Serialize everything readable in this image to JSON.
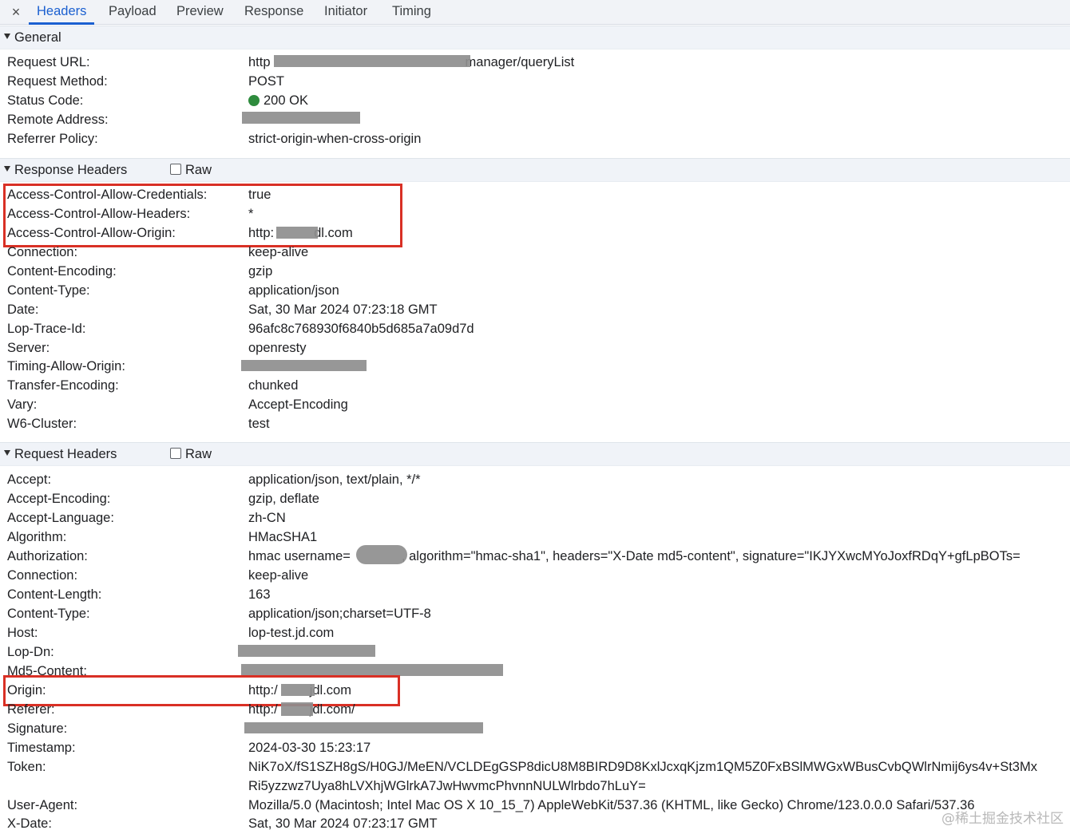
{
  "tabs": {
    "close_icon": "×",
    "items": [
      {
        "label": "Headers",
        "active": true
      },
      {
        "label": "Payload"
      },
      {
        "label": "Preview"
      },
      {
        "label": "Response"
      },
      {
        "label": "Initiator"
      },
      {
        "label": "Timing"
      }
    ]
  },
  "general": {
    "title": "General",
    "rows": [
      {
        "key": "Request URL:",
        "value_prefix": "http",
        "value_suffix": "manager/queryList"
      },
      {
        "key": "Request Method:",
        "value": "POST"
      },
      {
        "key": "Status Code:",
        "value": "200 OK"
      },
      {
        "key": "Remote Address:",
        "value": ""
      },
      {
        "key": "Referrer Policy:",
        "value": "strict-origin-when-cross-origin"
      }
    ]
  },
  "response_headers": {
    "title": "Response Headers",
    "raw_label": "Raw",
    "rows": [
      {
        "key": "Access-Control-Allow-Credentials:",
        "value": "true"
      },
      {
        "key": "Access-Control-Allow-Headers:",
        "value": "*"
      },
      {
        "key": "Access-Control-Allow-Origin:",
        "value_prefix": "http:",
        "value_suffix": "dl.com"
      },
      {
        "key": "Connection:",
        "value": "keep-alive"
      },
      {
        "key": "Content-Encoding:",
        "value": "gzip"
      },
      {
        "key": "Content-Type:",
        "value": "application/json"
      },
      {
        "key": "Date:",
        "value": "Sat, 30 Mar 2024 07:23:18 GMT"
      },
      {
        "key": "Lop-Trace-Id:",
        "value": "96afc8c768930f6840b5d685a7a09d7d"
      },
      {
        "key": "Server:",
        "value": "openresty"
      },
      {
        "key": "Timing-Allow-Origin:",
        "value": ""
      },
      {
        "key": "Transfer-Encoding:",
        "value": "chunked"
      },
      {
        "key": "Vary:",
        "value": "Accept-Encoding"
      },
      {
        "key": "W6-Cluster:",
        "value": "test"
      }
    ]
  },
  "request_headers": {
    "title": "Request Headers",
    "raw_label": "Raw",
    "rows": [
      {
        "key": "Accept:",
        "value": "application/json, text/plain, */*"
      },
      {
        "key": "Accept-Encoding:",
        "value": "gzip, deflate"
      },
      {
        "key": "Accept-Language:",
        "value": "zh-CN"
      },
      {
        "key": "Algorithm:",
        "value": "HMacSHA1"
      },
      {
        "key": "Authorization:",
        "value_prefix": "hmac username=",
        "value_suffix": ", algorithm=\"hmac-sha1\", headers=\"X-Date md5-content\", signature=\"IKJYXwcMYoJoxfRDqY+gfLpBOTs="
      },
      {
        "key": "Connection:",
        "value": "keep-alive"
      },
      {
        "key": "Content-Length:",
        "value": "163"
      },
      {
        "key": "Content-Type:",
        "value": "application/json;charset=UTF-8"
      },
      {
        "key": "Host:",
        "value": "lop-test.jd.com"
      },
      {
        "key": "Lop-Dn:",
        "value": ""
      },
      {
        "key": "Md5-Content:",
        "value": ""
      },
      {
        "key": "Origin:",
        "value_prefix": "http:/",
        "value_suffix": "jdl.com"
      },
      {
        "key": "Referer:",
        "value_prefix": "http:/",
        "value_suffix": "jdl.com/"
      },
      {
        "key": "Signature:",
        "value": ""
      },
      {
        "key": "Timestamp:",
        "value": "2024-03-30 15:23:17"
      },
      {
        "key": "Token:",
        "value": "NiK7oX/fS1SZH8gS/H0GJ/MeEN/VCLDEgGSP8dicU8M8BIRD9D8KxlJcxqKjzm1QM5Z0FxBSlMWGxWBusCvbQWlrNmij6ys4v+St3Mx",
        "value_line2": "Ri5yzzwz7Uya8hLVXhjWGlrkA7JwHwvmcPhvnnNULWlrbdo7hLuY="
      },
      {
        "key": "User-Agent:",
        "value": "Mozilla/5.0 (Macintosh; Intel Mac OS X 10_15_7) AppleWebKit/537.36 (KHTML, like Gecko) Chrome/123.0.0.0 Safari/537.36"
      },
      {
        "key": "X-Date:",
        "value": "Sat, 30 Mar 2024 07:23:17 GMT"
      }
    ]
  },
  "watermark": "@稀土掘金技术社区",
  "colors": {
    "accent": "#1a5fd0",
    "highlight": "#d93025",
    "status_ok": "#2e8b3d"
  }
}
